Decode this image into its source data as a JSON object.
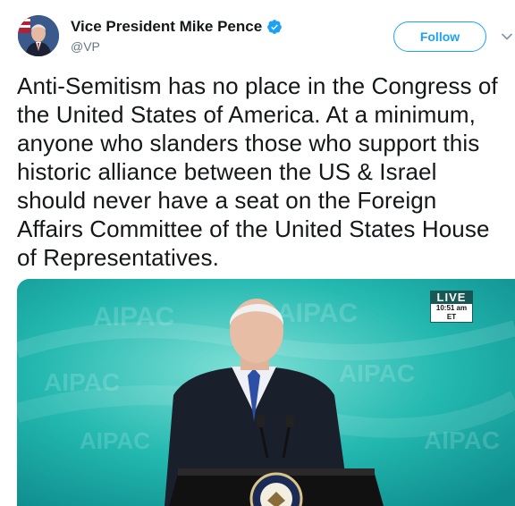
{
  "author": {
    "display_name": "Vice President Mike Pence",
    "handle": "@VP",
    "avatar_icon": "profile-photo-icon",
    "verified_icon": "verified-badge-icon"
  },
  "actions": {
    "follow_label": "Follow",
    "more_icon": "chevron-down-icon"
  },
  "tweet": {
    "text": "Anti-Semitism has no place in the Congress of the United States of America.  At a minimum, anyone who slanders those who support this historic alliance between the US & Israel should never have a seat on the Foreign Affairs Committee of the United States House of Representatives."
  },
  "media": {
    "live_label": "LIVE",
    "live_time": "10:51 am ET",
    "backdrop_text": "AIPAC",
    "podium_seal_text": "PRESIDENT OF THE UNITED STATES"
  },
  "colors": {
    "accent": "#1da1f2",
    "verified": "#1da1f2",
    "backdrop": "#1fb7b1"
  }
}
